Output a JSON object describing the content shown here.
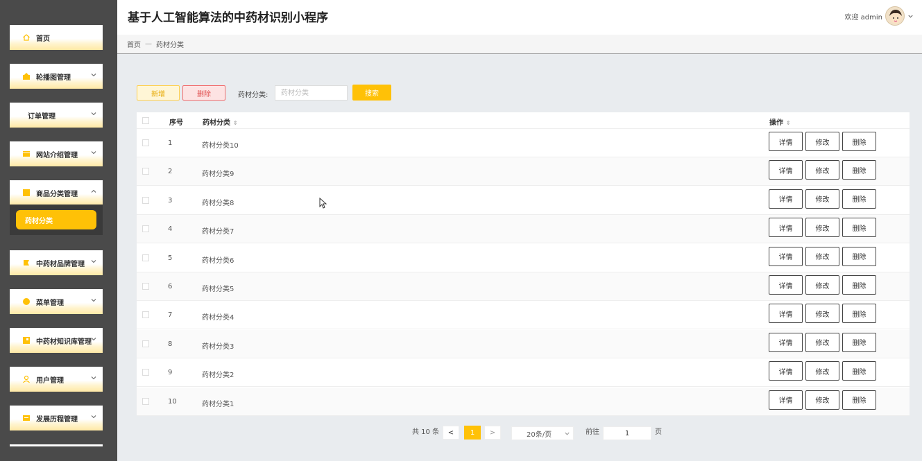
{
  "header": {
    "title": "基于人工智能算法的中药材识别小程序",
    "welcome": "欢迎 admin"
  },
  "sidebar": {
    "items": [
      {
        "label": "首页",
        "icon": "home-icon"
      },
      {
        "label": "轮播图管理",
        "icon": "carousel-icon"
      },
      {
        "label": "订单管理",
        "icon": ""
      },
      {
        "label": "网站介绍管理",
        "icon": "info-icon"
      },
      {
        "label": "商品分类管理",
        "icon": "category-icon"
      },
      {
        "label": "中药材品牌管理",
        "icon": "brand-icon"
      },
      {
        "label": "菜单管理",
        "icon": "menu-icon"
      },
      {
        "label": "中药材知识库管理",
        "icon": "knowledge-icon"
      },
      {
        "label": "用户管理",
        "icon": "user-icon"
      },
      {
        "label": "发展历程管理",
        "icon": "history-icon"
      }
    ],
    "active_sub": "药材分类",
    "accent": "#ffc107"
  },
  "breadcrumb": {
    "home": "首页",
    "sep": "—",
    "current": "药材分类"
  },
  "toolbar": {
    "add_label": "新增",
    "delete_label": "删除",
    "search_label": "药材分类:",
    "search_placeholder": "药材分类",
    "search_button": "搜索"
  },
  "table": {
    "columns": {
      "index": "序号",
      "name": "药材分类",
      "actions": "操作"
    },
    "action_labels": {
      "detail": "详情",
      "edit": "修改",
      "delete": "删除"
    },
    "rows": [
      {
        "index": "1",
        "name": "药材分类10"
      },
      {
        "index": "2",
        "name": "药材分类9"
      },
      {
        "index": "3",
        "name": "药材分类8"
      },
      {
        "index": "4",
        "name": "药材分类7"
      },
      {
        "index": "5",
        "name": "药材分类6"
      },
      {
        "index": "6",
        "name": "药材分类5"
      },
      {
        "index": "7",
        "name": "药材分类4"
      },
      {
        "index": "8",
        "name": "药材分类3"
      },
      {
        "index": "9",
        "name": "药材分类2"
      },
      {
        "index": "10",
        "name": "药材分类1"
      }
    ]
  },
  "pagination": {
    "total": "共 10 条",
    "prev": "<",
    "current": "1",
    "next": ">",
    "page_size": "20条/页",
    "goto_label": "前往",
    "goto_value": "1",
    "page_unit": "页"
  }
}
